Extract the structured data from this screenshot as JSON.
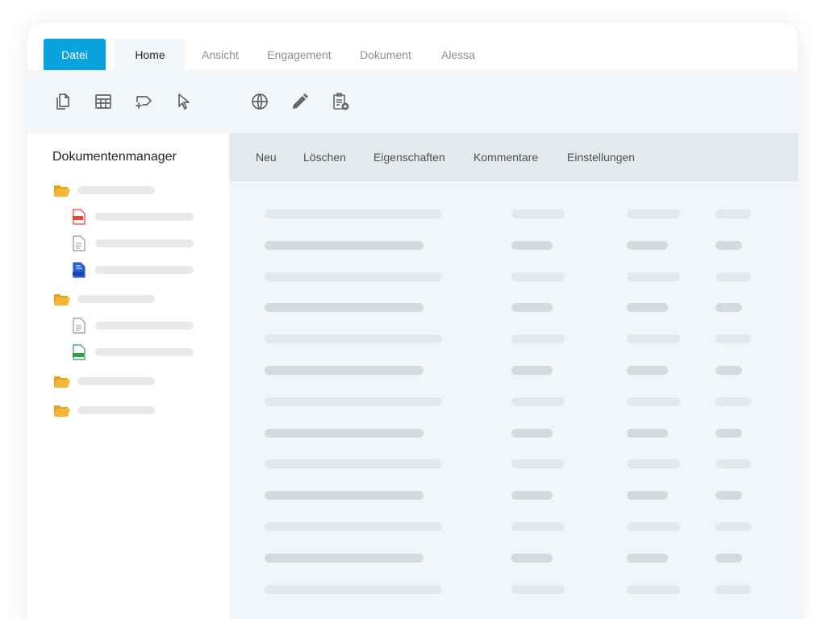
{
  "tabs": {
    "datei": "Datei",
    "home": "Home",
    "ansicht": "Ansicht",
    "engagement": "Engagement",
    "dokument": "Dokument",
    "alessa": "Alessa"
  },
  "ribbon": {
    "tools": [
      "copy-icon",
      "table-icon",
      "insert-comment-icon",
      "cursor-icon",
      "globe-icon",
      "pencil-icon",
      "clipboard-add-icon"
    ]
  },
  "sidebar": {
    "title": "Dokumentenmanager",
    "file_types": [
      "pdf",
      "txt",
      "docx",
      "txt",
      "xlsx"
    ]
  },
  "actions": {
    "neu": "Neu",
    "loeschen": "Löschen",
    "eigenschaften": "Eigenschaften",
    "kommentare": "Kommentare",
    "einstellungen": "Einstellungen"
  },
  "colors": {
    "accent": "#0aa3e0",
    "folder": "#f5b731",
    "pdf": "#e2473b",
    "docx": "#2b5fd6",
    "xlsx": "#2e9e4f"
  }
}
